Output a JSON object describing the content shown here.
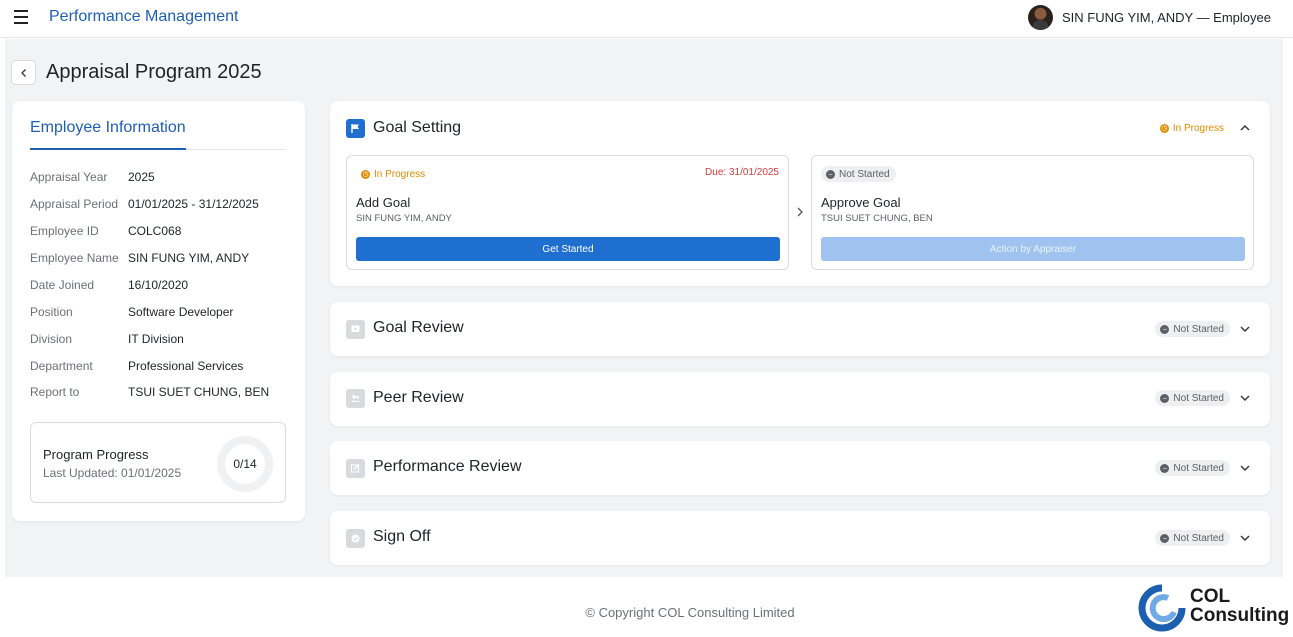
{
  "header": {
    "app_title": "Performance Management",
    "user_label": "SIN FUNG YIM, ANDY — Employee"
  },
  "page": {
    "title": "Appraisal Program 2025"
  },
  "employee_info": {
    "title": "Employee Information",
    "rows": [
      {
        "label": "Appraisal Year",
        "value": "2025"
      },
      {
        "label": "Appraisal Period",
        "value": "01/01/2025 - 31/12/2025"
      },
      {
        "label": "Employee ID",
        "value": "COLC068"
      },
      {
        "label": "Employee Name",
        "value": "SIN FUNG YIM, ANDY"
      },
      {
        "label": "Date Joined",
        "value": "16/10/2020"
      },
      {
        "label": "Position",
        "value": "Software Developer"
      },
      {
        "label": "Division",
        "value": "IT Division"
      },
      {
        "label": "Department",
        "value": "Professional Services"
      },
      {
        "label": "Report to",
        "value": "TSUI SUET CHUNG, BEN"
      }
    ],
    "progress": {
      "title": "Program Progress",
      "last_updated": "Last Updated: 01/01/2025",
      "value": "0/14"
    }
  },
  "sections": [
    {
      "title": "Goal Setting",
      "status": "In Progress",
      "icon": "flag-icon",
      "expanded": true,
      "tasks": [
        {
          "status": "In Progress",
          "due": "Due: 31/01/2025",
          "name": "Add Goal",
          "person": "SIN FUNG YIM, ANDY",
          "button": "Get Started"
        },
        {
          "status": "Not Started",
          "name": "Approve Goal",
          "person": "TSUI SUET CHUNG, BEN",
          "button": "Action by Appraiser"
        }
      ]
    },
    {
      "title": "Goal Review",
      "status": "Not Started",
      "icon": "review-icon",
      "expanded": false
    },
    {
      "title": "Peer Review",
      "status": "Not Started",
      "icon": "people-icon",
      "expanded": false
    },
    {
      "title": "Performance Review",
      "status": "Not Started",
      "icon": "edit-icon",
      "expanded": false
    },
    {
      "title": "Sign Off",
      "status": "Not Started",
      "icon": "check-circle-icon",
      "expanded": false
    }
  ],
  "footer": {
    "copyright": "© Copyright COL Consulting Limited",
    "logo_line1": "COL",
    "logo_line2": "Consulting"
  },
  "colors": {
    "primary": "#1f6fd1",
    "title_blue": "#1f5fb3",
    "in_progress": "#e08a00",
    "due_red": "#d43b3b"
  }
}
